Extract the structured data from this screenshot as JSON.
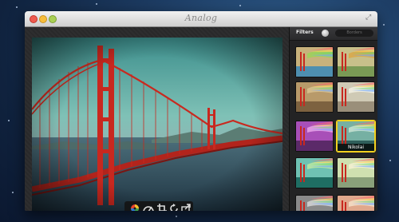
{
  "window": {
    "title": "Analog"
  },
  "sidebar": {
    "tab_filters": "Filters",
    "tab_other": "Borders",
    "thumbnails": [
      {
        "name": "",
        "tint": [
          "#4e8fb0",
          "#c8b27c",
          "#9fd05a"
        ]
      },
      {
        "name": "",
        "tint": [
          "#7a9a55",
          "#c8c08a",
          "#d9a94a"
        ]
      },
      {
        "name": "",
        "tint": [
          "#7d6240",
          "#b89a6a",
          "#d8c08e"
        ]
      },
      {
        "name": "",
        "tint": [
          "#9a8f7a",
          "#cfcab5",
          "#f0ede0"
        ]
      },
      {
        "name": "",
        "tint": [
          "#5b2a69",
          "#a84fb8",
          "#e59ee6"
        ]
      },
      {
        "name": "Nikolai",
        "tint": [
          "#2f5f5a",
          "#76b0a3",
          "#c5e0cf"
        ]
      },
      {
        "name": "",
        "tint": [
          "#1f6e63",
          "#6fc2b3",
          "#b8e6a3"
        ]
      },
      {
        "name": "",
        "tint": [
          "#8aa07a",
          "#cfe0b0",
          "#f2f0d0"
        ]
      },
      {
        "name": "",
        "tint": [
          "#3c3c3c",
          "#8a8a8a",
          "#d0d0d0"
        ]
      },
      {
        "name": "",
        "tint": [
          "#b06e5a",
          "#e0a88c",
          "#f3dcc4"
        ]
      }
    ]
  },
  "colors": {
    "selected_border": "#f3d11f",
    "bridge": "#c8281f"
  },
  "icons": [
    "color-wheel-icon",
    "adjust-icon",
    "crop-icon",
    "rotate-icon",
    "share-icon"
  ]
}
